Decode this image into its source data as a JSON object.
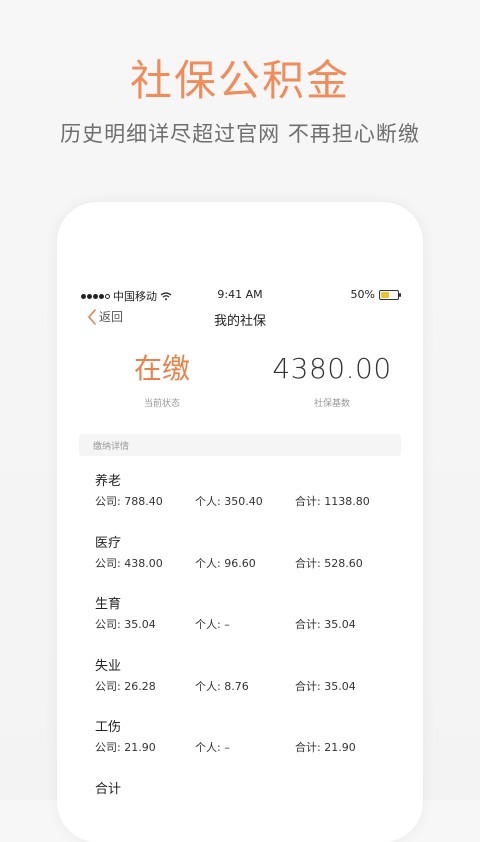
{
  "promo": {
    "title": "社保公积金",
    "subtitle": "历史明细详尽超过官网  不再担心断缴"
  },
  "status_bar": {
    "carrier": "中国移动",
    "time": "9:41 AM",
    "battery": "50%",
    "battery_level": 0.5
  },
  "nav": {
    "back_label": "返回",
    "title": "我的社保"
  },
  "summary": {
    "status_value": "在缴",
    "status_label": "当前状态",
    "base_value": "4380.00",
    "base_label": "社保基数"
  },
  "section": {
    "title": "缴纳详情"
  },
  "items": [
    {
      "name": "养老",
      "company": "公司: 788.40",
      "personal": "个人: 350.40",
      "total": "合计: 1138.80"
    },
    {
      "name": "医疗",
      "company": "公司: 438.00",
      "personal": "个人: 96.60",
      "total": "合计: 528.60"
    },
    {
      "name": "生育",
      "company": "公司: 35.04",
      "personal": "个人: –",
      "total": "合计: 35.04"
    },
    {
      "name": "失业",
      "company": "公司: 26.28",
      "personal": "个人: 8.76",
      "total": "合计: 35.04"
    },
    {
      "name": "工伤",
      "company": "公司: 21.90",
      "personal": "个人: –",
      "total": "合计: 21.90"
    },
    {
      "name": "合计",
      "company": "",
      "personal": "",
      "total": ""
    }
  ],
  "colors": {
    "accent": "#e9824a",
    "promo_title": "#f08c5a",
    "battery_fill": "#f2c12e"
  }
}
